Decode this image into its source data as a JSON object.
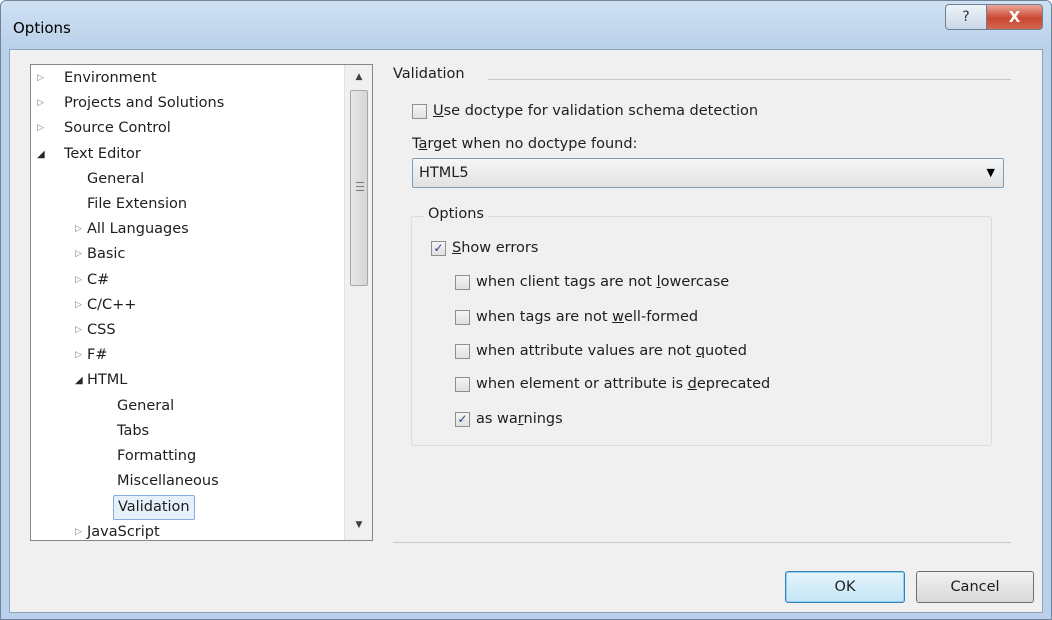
{
  "window": {
    "title": "Options",
    "help_glyph": "?",
    "close_glyph": "X"
  },
  "tree": {
    "items": [
      {
        "label": "Environment",
        "expander": "▷"
      },
      {
        "label": "Projects and Solutions",
        "expander": "▷"
      },
      {
        "label": "Source Control",
        "expander": "▷"
      },
      {
        "label": "Text Editor",
        "expander": "◢"
      },
      {
        "label": "General",
        "expander": ""
      },
      {
        "label": "File Extension",
        "expander": ""
      },
      {
        "label": "All Languages",
        "expander": "▷"
      },
      {
        "label": "Basic",
        "expander": "▷"
      },
      {
        "label": "C#",
        "expander": "▷"
      },
      {
        "label": "C/C++",
        "expander": "▷"
      },
      {
        "label": "CSS",
        "expander": "▷"
      },
      {
        "label": "F#",
        "expander": "▷"
      },
      {
        "label": "HTML",
        "expander": "◢"
      },
      {
        "label": "General",
        "expander": ""
      },
      {
        "label": "Tabs",
        "expander": ""
      },
      {
        "label": "Formatting",
        "expander": ""
      },
      {
        "label": "Miscellaneous",
        "expander": ""
      },
      {
        "label": "Validation",
        "expander": "",
        "selected": true
      },
      {
        "label": "JavaScript",
        "expander": "▷"
      }
    ],
    "scroll_up": "▲",
    "scroll_down": "▼"
  },
  "panel": {
    "section_title": "Validation",
    "use_doctype": {
      "pre": "",
      "key": "U",
      "post": "se doctype for validation schema detection",
      "checked": false
    },
    "target_label": {
      "pre": "T",
      "key": "a",
      "post": "rget when no doctype found:"
    },
    "target_value": "HTML5",
    "options_group": "Options",
    "show_errors": {
      "pre": "",
      "key": "S",
      "post": "how errors",
      "checked": true
    },
    "opt_lowercase": {
      "pre": "when client tags are not ",
      "key": "l",
      "post": "owercase",
      "checked": false
    },
    "opt_wellformed": {
      "pre": "when tags are not ",
      "key": "w",
      "post": "ell-formed",
      "checked": false
    },
    "opt_quoted": {
      "pre": "when attribute values are not ",
      "key": "q",
      "post": "uoted",
      "checked": false
    },
    "opt_deprecated": {
      "pre": "when element or attribute is ",
      "key": "d",
      "post": "eprecated",
      "checked": false
    },
    "opt_warnings": {
      "pre": "as wa",
      "key": "r",
      "post": "nings",
      "checked": true
    }
  },
  "buttons": {
    "ok": "OK",
    "cancel": "Cancel"
  },
  "glyphs": {
    "check": "✓",
    "dropdown": "▼"
  }
}
